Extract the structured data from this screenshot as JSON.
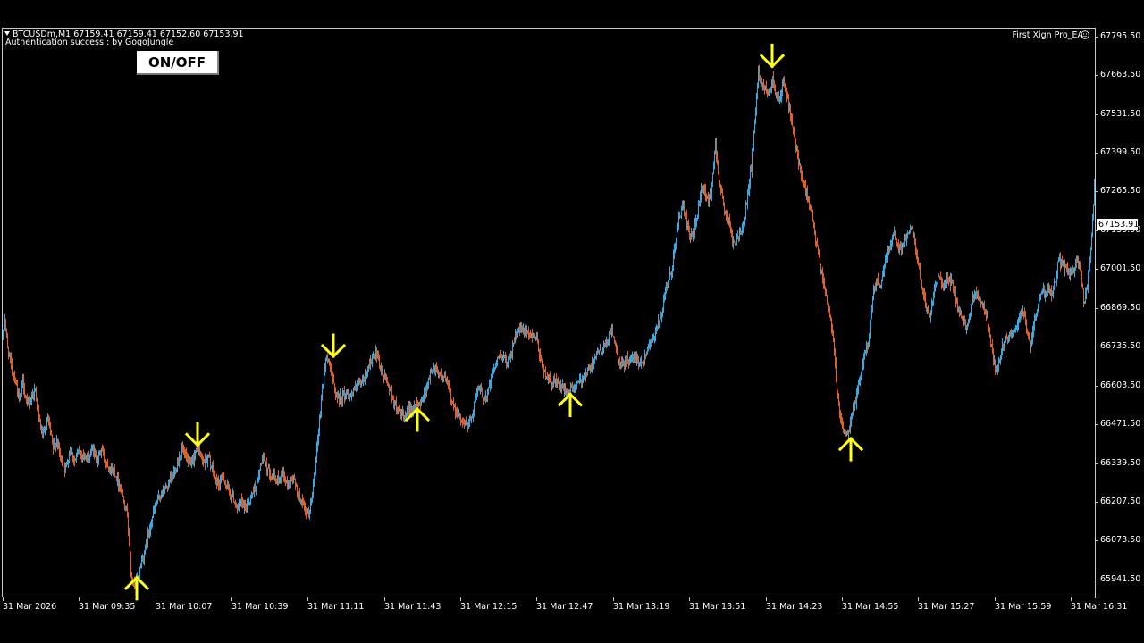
{
  "header": {
    "symbol_line": "BTCUSDm,M1  67159.41 67159.41 67152.60 67153.91",
    "auth_line": "Authentication success : by GogoJungle",
    "ea_name": "First Xign Pro_EA",
    "ea_icon": "smiley-icon"
  },
  "controls": {
    "onoff_label": "ON/OFF"
  },
  "price_axis": {
    "labels": [
      "67795.50",
      "67663.50",
      "67531.50",
      "67399.50",
      "67265.50",
      "67133.50",
      "67001.50",
      "66869.50",
      "66735.50",
      "66603.50",
      "66471.50",
      "66339.50",
      "66207.50",
      "66073.50",
      "65941.50"
    ],
    "current_price": "67153.91"
  },
  "time_axis": {
    "labels": [
      "31 Mar 2026",
      "31 Mar 09:35",
      "31 Mar 10:07",
      "31 Mar 10:39",
      "31 Mar 11:11",
      "31 Mar 11:43",
      "31 Mar 12:15",
      "31 Mar 12:47",
      "31 Mar 13:19",
      "31 Mar 13:51",
      "31 Mar 14:23",
      "31 Mar 14:55",
      "31 Mar 15:27",
      "31 Mar 15:59",
      "31 Mar 16:31"
    ]
  },
  "colors": {
    "background": "#000000",
    "bull": "#3aa8e0",
    "bear": "#e0602a",
    "signal_arrow": "#ffff1a",
    "axis": "#c8c8c8",
    "text": "#ffffff"
  },
  "chart_data": {
    "type": "candlestick",
    "ylim": [
      65920,
      67840
    ],
    "price_path": [
      [
        0,
        66800
      ],
      [
        2,
        66860
      ],
      [
        5,
        66760
      ],
      [
        9,
        66700
      ],
      [
        14,
        66650
      ],
      [
        18,
        66580
      ],
      [
        22,
        66650
      ],
      [
        27,
        66560
      ],
      [
        31,
        66590
      ],
      [
        36,
        66620
      ],
      [
        40,
        66520
      ],
      [
        45,
        66460
      ],
      [
        50,
        66520
      ],
      [
        56,
        66420
      ],
      [
        60,
        66450
      ],
      [
        65,
        66380
      ],
      [
        70,
        66350
      ],
      [
        75,
        66420
      ],
      [
        80,
        66380
      ],
      [
        85,
        66410
      ],
      [
        90,
        66400
      ],
      [
        95,
        66380
      ],
      [
        100,
        66420
      ],
      [
        105,
        66380
      ],
      [
        110,
        66420
      ],
      [
        115,
        66380
      ],
      [
        120,
        66350
      ],
      [
        125,
        66340
      ],
      [
        130,
        66300
      ],
      [
        135,
        66250
      ],
      [
        139,
        66200
      ],
      [
        143,
        66000
      ],
      [
        147,
        65950
      ],
      [
        151,
        65990
      ],
      [
        155,
        66040
      ],
      [
        159,
        66080
      ],
      [
        163,
        66140
      ],
      [
        167,
        66190
      ],
      [
        171,
        66230
      ],
      [
        175,
        66260
      ],
      [
        180,
        66280
      ],
      [
        185,
        66300
      ],
      [
        190,
        66330
      ],
      [
        195,
        66370
      ],
      [
        200,
        66420
      ],
      [
        205,
        66380
      ],
      [
        210,
        66360
      ],
      [
        214,
        66400
      ],
      [
        218,
        66420
      ],
      [
        222,
        66390
      ],
      [
        226,
        66370
      ],
      [
        230,
        66390
      ],
      [
        234,
        66350
      ],
      [
        238,
        66310
      ],
      [
        242,
        66300
      ],
      [
        246,
        66330
      ],
      [
        250,
        66290
      ],
      [
        254,
        66270
      ],
      [
        258,
        66250
      ],
      [
        262,
        66220
      ],
      [
        266,
        66240
      ],
      [
        270,
        66220
      ],
      [
        275,
        66240
      ],
      [
        280,
        66280
      ],
      [
        285,
        66310
      ],
      [
        289,
        66380
      ],
      [
        293,
        66370
      ],
      [
        297,
        66350
      ],
      [
        301,
        66330
      ],
      [
        305,
        66310
      ],
      [
        309,
        66320
      ],
      [
        313,
        66340
      ],
      [
        317,
        66300
      ],
      [
        321,
        66310
      ],
      [
        325,
        66320
      ],
      [
        329,
        66270
      ],
      [
        333,
        66250
      ],
      [
        337,
        66210
      ],
      [
        341,
        66190
      ],
      [
        345,
        66240
      ],
      [
        349,
        66360
      ],
      [
        353,
        66480
      ],
      [
        357,
        66620
      ],
      [
        361,
        66720
      ],
      [
        365,
        66720
      ],
      [
        369,
        66650
      ],
      [
        373,
        66600
      ],
      [
        377,
        66590
      ],
      [
        381,
        66600
      ],
      [
        385,
        66610
      ],
      [
        389,
        66600
      ],
      [
        393,
        66620
      ],
      [
        397,
        66630
      ],
      [
        401,
        66640
      ],
      [
        405,
        66670
      ],
      [
        409,
        66700
      ],
      [
        413,
        66720
      ],
      [
        417,
        66740
      ],
      [
        421,
        66700
      ],
      [
        425,
        66670
      ],
      [
        429,
        66650
      ],
      [
        433,
        66620
      ],
      [
        437,
        66580
      ],
      [
        441,
        66550
      ],
      [
        445,
        66540
      ],
      [
        449,
        66520
      ],
      [
        453,
        66550
      ],
      [
        457,
        66560
      ],
      [
        461,
        66560
      ],
      [
        465,
        66570
      ],
      [
        469,
        66590
      ],
      [
        473,
        66620
      ],
      [
        477,
        66660
      ],
      [
        481,
        66690
      ],
      [
        485,
        66690
      ],
      [
        489,
        66670
      ],
      [
        493,
        66660
      ],
      [
        497,
        66640
      ],
      [
        501,
        66590
      ],
      [
        505,
        66560
      ],
      [
        509,
        66530
      ],
      [
        513,
        66520
      ],
      [
        517,
        66500
      ],
      [
        521,
        66500
      ],
      [
        525,
        66540
      ],
      [
        529,
        66600
      ],
      [
        533,
        66620
      ],
      [
        537,
        66600
      ],
      [
        541,
        66600
      ],
      [
        545,
        66640
      ],
      [
        549,
        66690
      ],
      [
        553,
        66720
      ],
      [
        557,
        66740
      ],
      [
        561,
        66720
      ],
      [
        565,
        66720
      ],
      [
        569,
        66750
      ],
      [
        573,
        66800
      ],
      [
        577,
        66820
      ],
      [
        581,
        66820
      ],
      [
        585,
        66810
      ],
      [
        589,
        66800
      ],
      [
        593,
        66810
      ],
      [
        597,
        66790
      ],
      [
        601,
        66730
      ],
      [
        605,
        66680
      ],
      [
        609,
        66660
      ],
      [
        613,
        66640
      ],
      [
        617,
        66650
      ],
      [
        621,
        66640
      ],
      [
        625,
        66630
      ],
      [
        629,
        66610
      ],
      [
        633,
        66610
      ],
      [
        637,
        66620
      ],
      [
        641,
        66640
      ],
      [
        645,
        66640
      ],
      [
        649,
        66660
      ],
      [
        653,
        66680
      ],
      [
        657,
        66690
      ],
      [
        661,
        66730
      ],
      [
        665,
        66740
      ],
      [
        669,
        66750
      ],
      [
        673,
        66760
      ],
      [
        677,
        66790
      ],
      [
        681,
        66830
      ],
      [
        685,
        66760
      ],
      [
        689,
        66710
      ],
      [
        693,
        66700
      ],
      [
        697,
        66720
      ],
      [
        701,
        66720
      ],
      [
        705,
        66730
      ],
      [
        709,
        66730
      ],
      [
        713,
        66710
      ],
      [
        717,
        66720
      ],
      [
        721,
        66760
      ],
      [
        725,
        66790
      ],
      [
        729,
        66800
      ],
      [
        733,
        66840
      ],
      [
        737,
        66880
      ],
      [
        741,
        66940
      ],
      [
        745,
        66990
      ],
      [
        749,
        67040
      ],
      [
        753,
        67140
      ],
      [
        757,
        67210
      ],
      [
        761,
        67240
      ],
      [
        765,
        67180
      ],
      [
        769,
        67130
      ],
      [
        773,
        67150
      ],
      [
        777,
        67210
      ],
      [
        781,
        67300
      ],
      [
        785,
        67300
      ],
      [
        789,
        67250
      ],
      [
        793,
        67300
      ],
      [
        797,
        67450
      ],
      [
        801,
        67330
      ],
      [
        805,
        67260
      ],
      [
        809,
        67200
      ],
      [
        813,
        67180
      ],
      [
        817,
        67110
      ],
      [
        821,
        67120
      ],
      [
        825,
        67150
      ],
      [
        829,
        67190
      ],
      [
        833,
        67280
      ],
      [
        837,
        67370
      ],
      [
        841,
        67530
      ],
      [
        845,
        67690
      ],
      [
        849,
        67660
      ],
      [
        853,
        67640
      ],
      [
        857,
        67620
      ],
      [
        861,
        67680
      ],
      [
        865,
        67620
      ],
      [
        869,
        67600
      ],
      [
        873,
        67660
      ],
      [
        877,
        67620
      ],
      [
        881,
        67540
      ],
      [
        885,
        67470
      ],
      [
        889,
        67410
      ],
      [
        893,
        67350
      ],
      [
        897,
        67300
      ],
      [
        901,
        67260
      ],
      [
        905,
        67210
      ],
      [
        909,
        67130
      ],
      [
        913,
        67060
      ],
      [
        917,
        67000
      ],
      [
        921,
        66930
      ],
      [
        925,
        66870
      ],
      [
        929,
        66800
      ],
      [
        933,
        66620
      ],
      [
        937,
        66520
      ],
      [
        941,
        66470
      ],
      [
        945,
        66460
      ],
      [
        949,
        66520
      ],
      [
        953,
        66570
      ],
      [
        957,
        66630
      ],
      [
        961,
        66690
      ],
      [
        965,
        66750
      ],
      [
        969,
        66800
      ],
      [
        973,
        66930
      ],
      [
        977,
        66990
      ],
      [
        981,
        66960
      ],
      [
        985,
        67020
      ],
      [
        989,
        67080
      ],
      [
        993,
        67120
      ],
      [
        997,
        67150
      ],
      [
        1001,
        67110
      ],
      [
        1005,
        67090
      ],
      [
        1009,
        67130
      ],
      [
        1013,
        67160
      ],
      [
        1017,
        67170
      ],
      [
        1021,
        67100
      ],
      [
        1025,
        67020
      ],
      [
        1029,
        66950
      ],
      [
        1033,
        66900
      ],
      [
        1037,
        66870
      ],
      [
        1041,
        66940
      ],
      [
        1045,
        66990
      ],
      [
        1049,
        67000
      ],
      [
        1053,
        66960
      ],
      [
        1057,
        67000
      ],
      [
        1061,
        66980
      ],
      [
        1065,
        66940
      ],
      [
        1069,
        66880
      ],
      [
        1073,
        66850
      ],
      [
        1077,
        66830
      ],
      [
        1081,
        66870
      ],
      [
        1085,
        66930
      ],
      [
        1089,
        66940
      ],
      [
        1093,
        66930
      ],
      [
        1097,
        66900
      ],
      [
        1101,
        66860
      ],
      [
        1105,
        66780
      ],
      [
        1109,
        66710
      ],
      [
        1113,
        66680
      ],
      [
        1117,
        66760
      ],
      [
        1121,
        66790
      ],
      [
        1125,
        66790
      ],
      [
        1129,
        66820
      ],
      [
        1133,
        66830
      ],
      [
        1137,
        66860
      ],
      [
        1141,
        66880
      ],
      [
        1145,
        66830
      ],
      [
        1149,
        66770
      ],
      [
        1153,
        66840
      ],
      [
        1157,
        66890
      ],
      [
        1161,
        66940
      ],
      [
        1165,
        66950
      ],
      [
        1169,
        66960
      ],
      [
        1173,
        66940
      ],
      [
        1177,
        66980
      ],
      [
        1181,
        67060
      ],
      [
        1185,
        67040
      ],
      [
        1189,
        67030
      ],
      [
        1193,
        67010
      ],
      [
        1197,
        67020
      ],
      [
        1201,
        67050
      ],
      [
        1205,
        67040
      ],
      [
        1209,
        66920
      ],
      [
        1213,
        66970
      ],
      [
        1217,
        67100
      ],
      [
        1220,
        67240
      ],
      [
        1222,
        67400
      ]
    ],
    "signals": [
      {
        "type": "buy",
        "x_index": 150,
        "price": 65990
      },
      {
        "type": "sell",
        "x_index": 218,
        "price": 66420
      },
      {
        "type": "sell",
        "x_index": 370,
        "price": 66720
      },
      {
        "type": "buy",
        "x_index": 464,
        "price": 66560
      },
      {
        "type": "buy",
        "x_index": 635,
        "price": 66610
      },
      {
        "type": "sell",
        "x_index": 861,
        "price": 67700
      },
      {
        "type": "buy",
        "x_index": 949,
        "price": 66460
      }
    ]
  }
}
